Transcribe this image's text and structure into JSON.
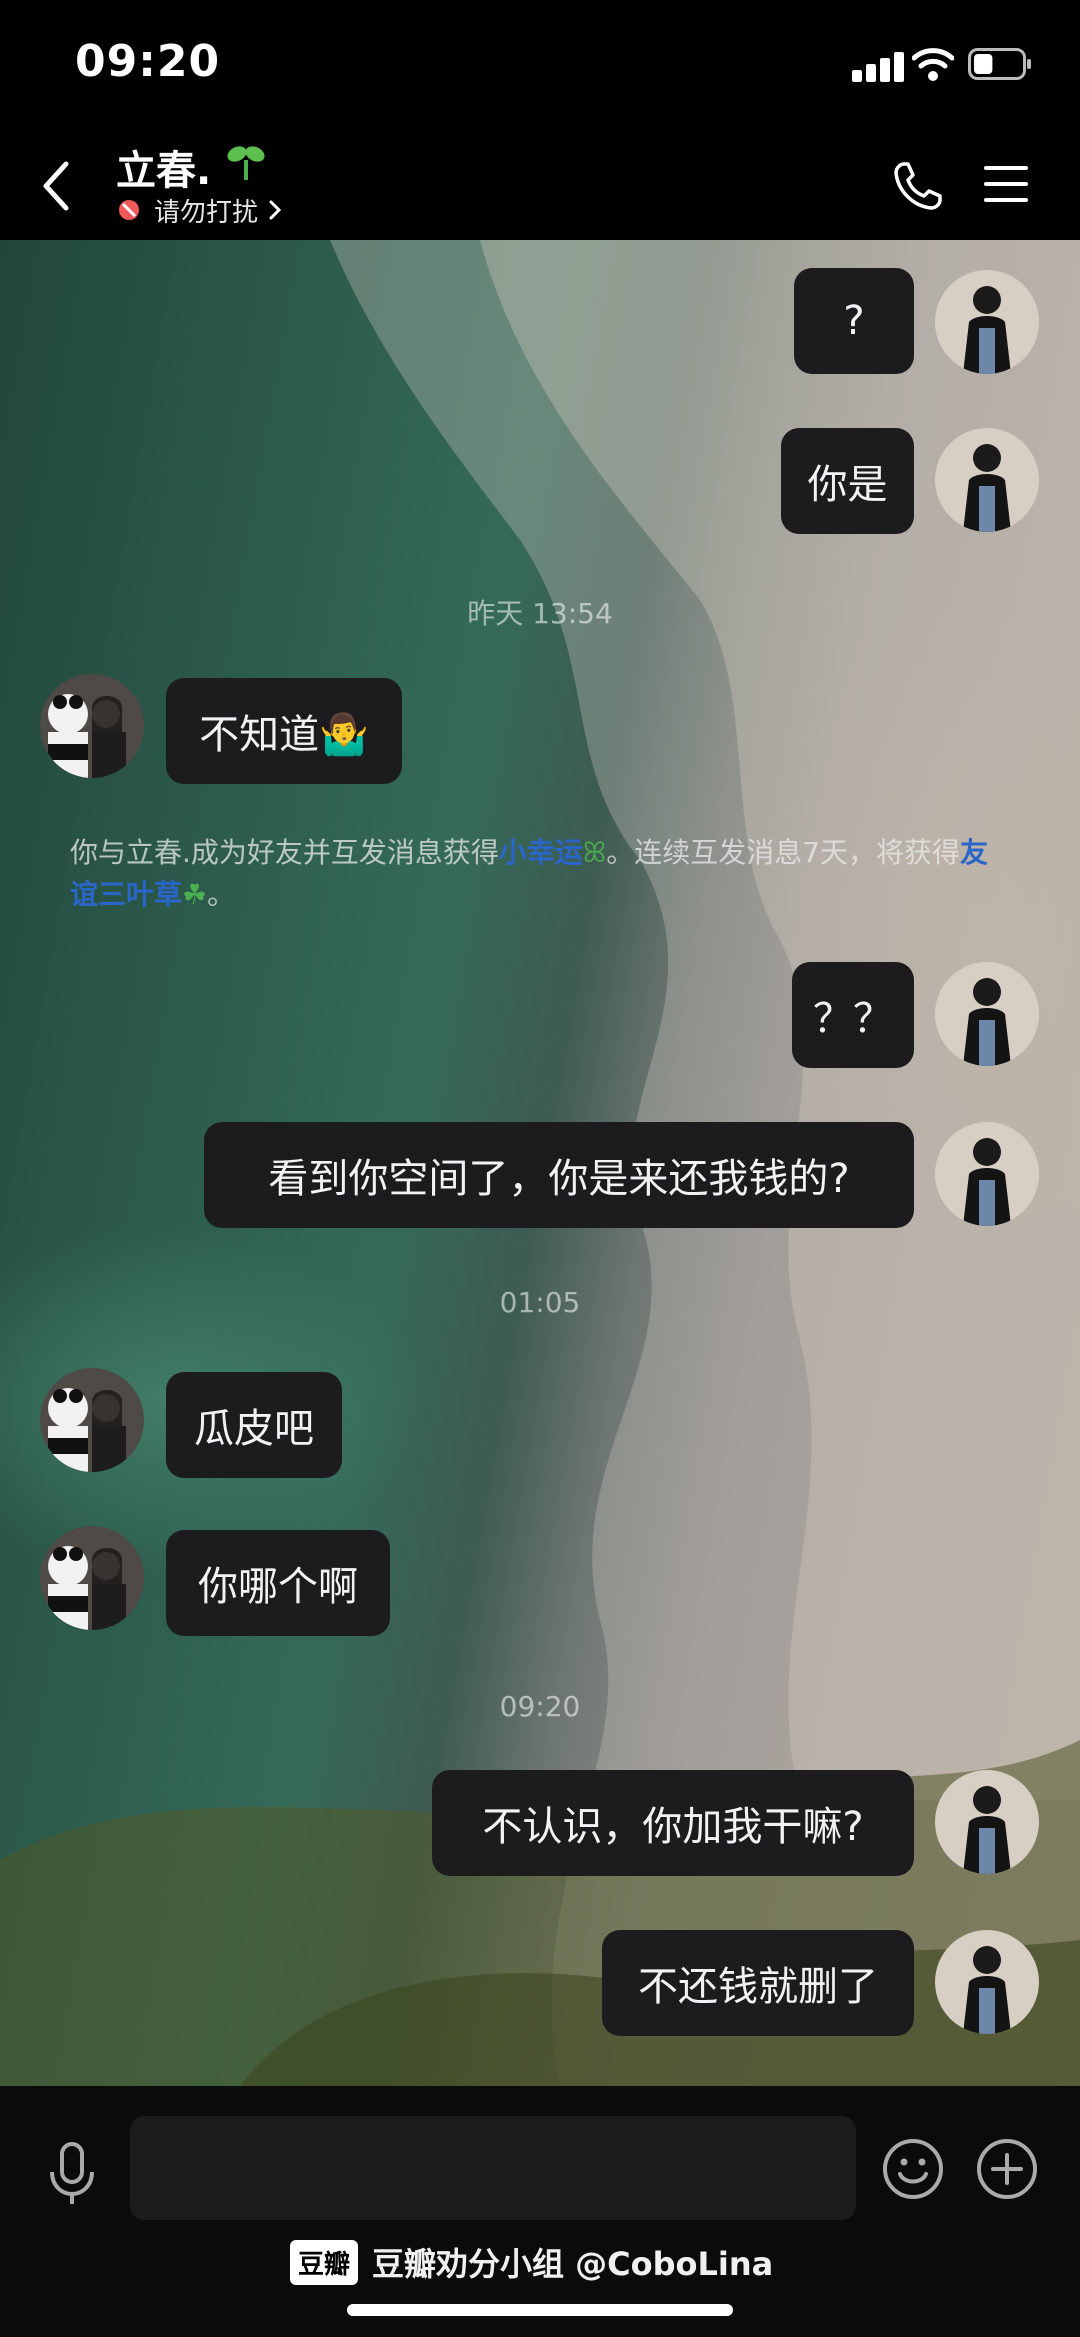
{
  "status_bar": {
    "time": "09:20",
    "battery_level": 0.4
  },
  "header": {
    "contact_name": "立春.",
    "status": "请勿打扰"
  },
  "messages": [
    {
      "side": "right",
      "text": "?"
    },
    {
      "side": "right",
      "text": "你是"
    },
    {
      "timestamp": "昨天 13:54"
    },
    {
      "side": "left",
      "text": "不知道🤷‍♂️"
    },
    {
      "system": true,
      "text_prefix": "你与立春.成为好友并互发消息获得",
      "highlight1": "小幸运",
      "text_middle": "。连续互发消息7天，将获得",
      "highlight2": "友谊三叶草",
      "text_suffix": "。"
    },
    {
      "side": "right",
      "text": "？？"
    },
    {
      "side": "right",
      "text": "看到你空间了，你是来还我钱的?"
    },
    {
      "timestamp": "01:05"
    },
    {
      "side": "left",
      "text": "瓜皮吧"
    },
    {
      "side": "left",
      "text": "你哪个啊"
    },
    {
      "timestamp": "09:20"
    },
    {
      "side": "right",
      "text": "不认识，你加我干嘛?"
    },
    {
      "side": "right",
      "text": "不还钱就删了"
    }
  ],
  "input": {
    "placeholder": ""
  },
  "watermark": {
    "logo": "豆瓣",
    "text": "豆瓣劝分小组 @CoboLina"
  }
}
